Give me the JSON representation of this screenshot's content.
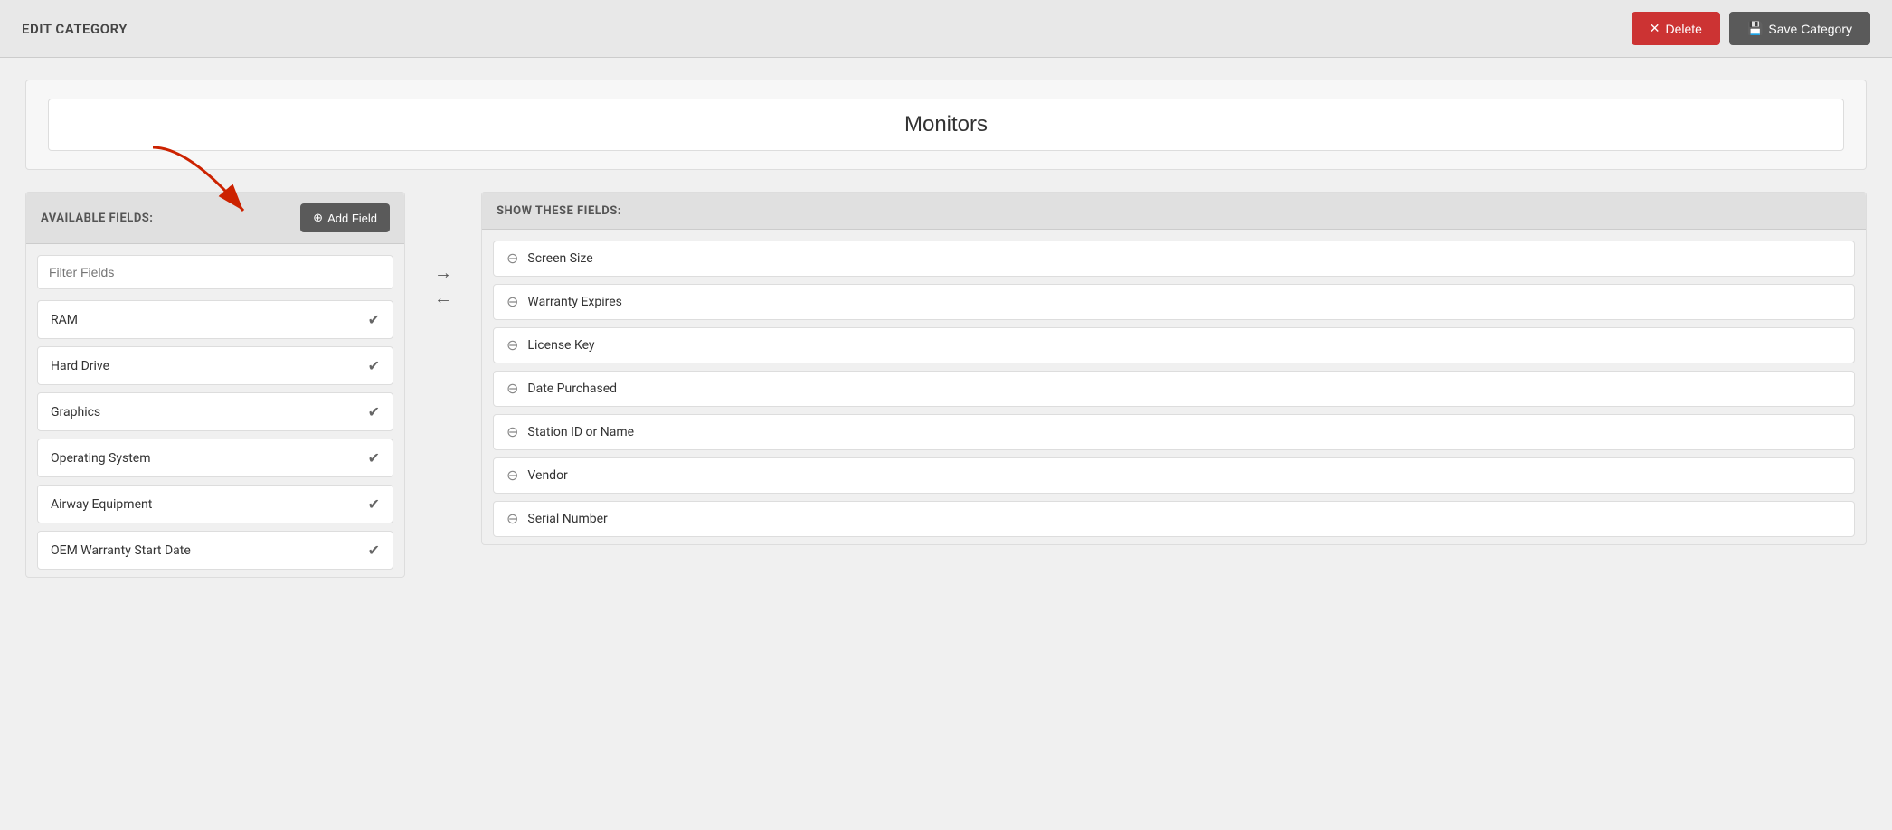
{
  "header": {
    "title": "EDIT CATEGORY",
    "delete_label": "Delete",
    "save_label": "Save Category"
  },
  "category": {
    "name": "Monitors"
  },
  "available_fields": {
    "section_title": "AVAILABLE FIELDS:",
    "add_button_label": "Add Field",
    "filter_placeholder": "Filter Fields",
    "items": [
      {
        "label": "RAM",
        "id": "ram"
      },
      {
        "label": "Hard Drive",
        "id": "hard-drive"
      },
      {
        "label": "Graphics",
        "id": "graphics"
      },
      {
        "label": "Operating System",
        "id": "operating-system"
      },
      {
        "label": "Airway Equipment",
        "id": "airway-equipment"
      },
      {
        "label": "OEM Warranty Start Date",
        "id": "oem-warranty"
      }
    ]
  },
  "show_fields": {
    "section_title": "SHOW THESE FIELDS:",
    "items": [
      {
        "label": "Screen Size",
        "id": "screen-size"
      },
      {
        "label": "Warranty Expires",
        "id": "warranty-expires"
      },
      {
        "label": "License Key",
        "id": "license-key"
      },
      {
        "label": "Date Purchased",
        "id": "date-purchased"
      },
      {
        "label": "Station ID or Name",
        "id": "station-id"
      },
      {
        "label": "Vendor",
        "id": "vendor"
      },
      {
        "label": "Serial Number",
        "id": "serial-number"
      }
    ]
  },
  "icons": {
    "delete_x": "✕",
    "save_disk": "💾",
    "add_plus": "⊕",
    "check_circle": "✔",
    "remove_circle": "⊖",
    "arrow_right": "→",
    "arrow_left": "←"
  }
}
